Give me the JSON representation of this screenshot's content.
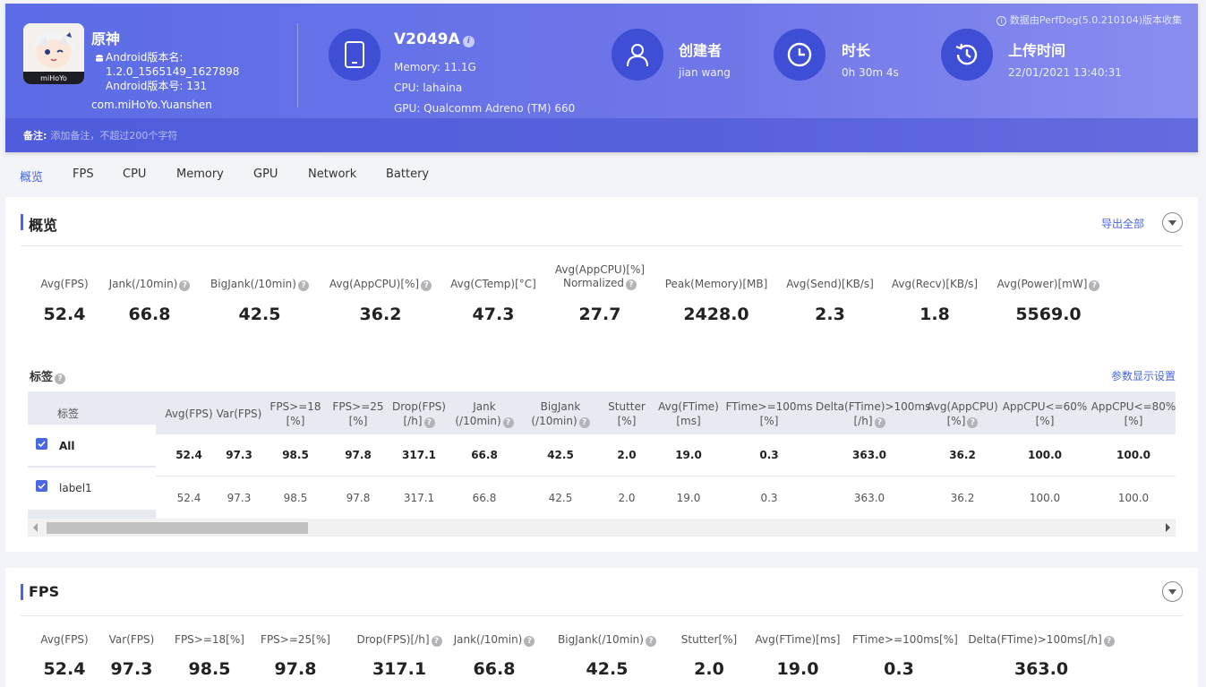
{
  "header": {
    "source_note": "数据由PerfDog(5.0.210104)版本收集",
    "app": {
      "name": "原神",
      "version_name_label": "Android版本名:",
      "version_name": "1.2.0_1565149_1627898",
      "version_code": "Android版本号: 131",
      "package": "com.miHoYo.Yuanshen",
      "icon_text": "miHoYo"
    },
    "device": {
      "name": "V2049A",
      "info_icon": "i",
      "memory": "Memory: 11.1G",
      "cpu": "CPU: lahaina",
      "gpu": "GPU: Qualcomm Adreno (TM) 660"
    },
    "creator": {
      "label": "创建者",
      "value": "jian wang"
    },
    "duration": {
      "label": "时长",
      "value": "0h 30m 4s"
    },
    "upload": {
      "label": "上传时间",
      "value": "22/01/2021 13:40:31"
    },
    "note": {
      "label": "备注:",
      "placeholder": "添加备注，不超过200个字符"
    }
  },
  "tabs": [
    "概览",
    "FPS",
    "CPU",
    "Memory",
    "GPU",
    "Network",
    "Battery"
  ],
  "overview": {
    "title": "概览",
    "export_label": "导出全部",
    "metrics": [
      {
        "label": "Avg(FPS)",
        "value": "52.4"
      },
      {
        "label": "Jank(/10min)",
        "value": "66.8"
      },
      {
        "label": "BigJank(/10min)",
        "value": "42.5"
      },
      {
        "label": "Avg(AppCPU)[%]",
        "value": "36.2"
      },
      {
        "label": "Avg(CTemp)[°C]",
        "value": "47.3"
      },
      {
        "label": "Avg(AppCPU)[%]",
        "label2": "Normalized",
        "value": "27.7"
      },
      {
        "label": "Peak(Memory)[MB]",
        "value": "2428.0"
      },
      {
        "label": "Avg(Send)[KB/s]",
        "value": "2.3"
      },
      {
        "label": "Avg(Recv)[KB/s]",
        "value": "1.8"
      },
      {
        "label": "Avg(Power)[mW]",
        "value": "5569.0"
      }
    ],
    "tags_title": "标签",
    "param_settings": "参数显示设置",
    "table": {
      "tag_header": "标签",
      "columns": [
        [
          "Avg(FPS)"
        ],
        [
          "Var(FPS)"
        ],
        [
          "FPS>=18",
          "[%]"
        ],
        [
          "FPS>=25",
          "[%]"
        ],
        [
          "Drop(FPS)",
          "[/h]"
        ],
        [
          "Jank",
          "(/10min)"
        ],
        [
          "BigJank",
          "(/10min)"
        ],
        [
          "Stutter",
          "[%]"
        ],
        [
          "Avg(FTime)",
          "[ms]"
        ],
        [
          "FTime>=100ms",
          "[%]"
        ],
        [
          "Delta(FTime)>100ms",
          "[/h]"
        ],
        [
          "Avg(AppCPU)",
          "[%]"
        ],
        [
          "AppCPU<=60%",
          "[%]"
        ],
        [
          "AppCPU<=80%",
          "[%]"
        ]
      ],
      "rows": [
        {
          "label": "All",
          "values": [
            "52.4",
            "97.3",
            "98.5",
            "97.8",
            "317.1",
            "66.8",
            "42.5",
            "2.0",
            "19.0",
            "0.3",
            "363.0",
            "36.2",
            "100.0",
            "100.0"
          ]
        },
        {
          "label": "label1",
          "values": [
            "52.4",
            "97.3",
            "98.5",
            "97.8",
            "317.1",
            "66.8",
            "42.5",
            "2.0",
            "19.0",
            "0.3",
            "363.0",
            "36.2",
            "100.0",
            "100.0"
          ]
        }
      ]
    }
  },
  "fps": {
    "title": "FPS",
    "metrics": [
      {
        "label": "Avg(FPS)",
        "value": "52.4"
      },
      {
        "label": "Var(FPS)",
        "value": "97.3"
      },
      {
        "label": "FPS>=18[%]",
        "value": "98.5"
      },
      {
        "label": "FPS>=25[%]",
        "value": "97.8"
      },
      {
        "label": "Drop(FPS)[/h]",
        "value": "317.1"
      },
      {
        "label": "Jank(/10min)",
        "value": "66.8"
      },
      {
        "label": "BigJank(/10min)",
        "value": "42.5"
      },
      {
        "label": "Stutter[%]",
        "value": "2.0"
      },
      {
        "label": "Avg(FTime)[ms]",
        "value": "19.0"
      },
      {
        "label": "FTime>=100ms[%]",
        "value": "0.3"
      },
      {
        "label": "Delta(FTime)>100ms[/h]",
        "value": "363.0"
      }
    ]
  }
}
